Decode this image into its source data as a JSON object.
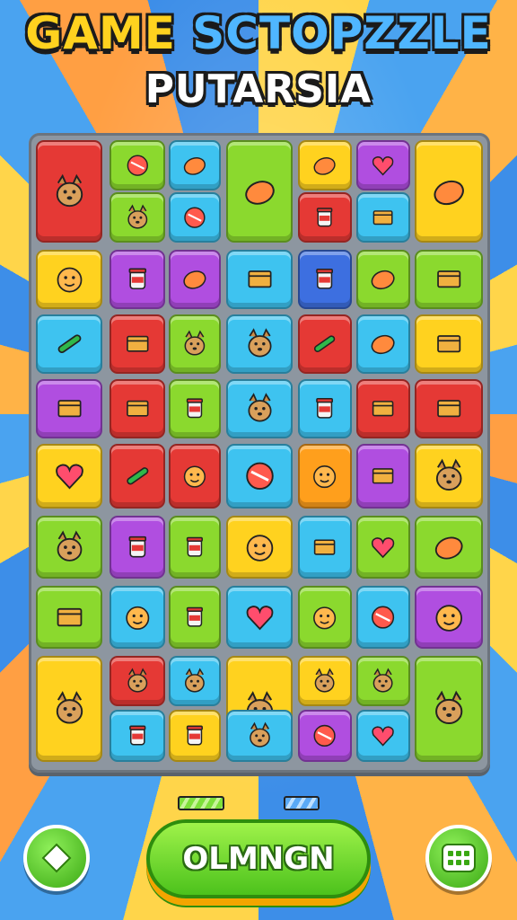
{
  "header": {
    "title_line1_a": "GAME ",
    "title_line1_b": "SCTO",
    "title_line1_c": "PZZLE",
    "title_line2": "PUTARSIA"
  },
  "action_button": {
    "label": "OLMNGN"
  },
  "icons": {
    "left_button": "diamond-icon",
    "right_button": "grid-icon"
  },
  "tiles": [
    {
      "icon": "fox-character",
      "color": "#e53935"
    },
    {
      "icon": "striped-ball",
      "color": "#8bd92e"
    },
    {
      "icon": "yellow-blob",
      "color": "#3ec3f0"
    },
    {
      "icon": "fruit-pile",
      "color": "#8bd92e"
    },
    {
      "icon": "red-fan",
      "color": "#ffd21f"
    },
    {
      "icon": "heart",
      "color": "#b04ee0"
    },
    {
      "icon": "arcade-machine",
      "color": "#ffd21f"
    },
    {
      "icon": "blue-bird",
      "color": "#8bd92e"
    },
    {
      "icon": "green-apple",
      "color": "#3ec3f0"
    },
    {
      "icon": "paper-cup",
      "color": "#e53935"
    },
    {
      "icon": "gift-box",
      "color": "#3ec3f0"
    },
    {
      "icon": "smiley",
      "color": "#ffd21f"
    },
    {
      "icon": "jam-jar",
      "color": "#b04ee0"
    },
    {
      "icon": "lightbulb",
      "color": "#b04ee0"
    },
    {
      "icon": "cheese-block",
      "color": "#3ec3f0"
    },
    {
      "icon": "honey-jar",
      "color": "#3d6fe0"
    },
    {
      "icon": "orange-vase",
      "color": "#8bd92e"
    },
    {
      "icon": "cake-slice",
      "color": "#8bd92e"
    },
    {
      "icon": "green-stick",
      "color": "#3ec3f0"
    },
    {
      "icon": "book",
      "color": "#e53935"
    },
    {
      "icon": "yellow-chick",
      "color": "#8bd92e"
    },
    {
      "icon": "cat-face",
      "color": "#3ec3f0"
    },
    {
      "icon": "red-check",
      "color": "#e53935"
    },
    {
      "icon": "pink-bean",
      "color": "#3ec3f0"
    },
    {
      "icon": "sandwich",
      "color": "#ffd21f"
    },
    {
      "icon": "colored-books",
      "color": "#b04ee0"
    },
    {
      "icon": "layer-cake",
      "color": "#e53935"
    },
    {
      "icon": "soda-can",
      "color": "#8bd92e"
    },
    {
      "icon": "hotdog",
      "color": "#3ec3f0"
    },
    {
      "icon": "drink-cup",
      "color": "#3ec3f0"
    },
    {
      "icon": "picture-frame",
      "color": "#e53935"
    },
    {
      "icon": "green-box",
      "color": "#e53935"
    },
    {
      "icon": "red-bow",
      "color": "#ffd21f"
    },
    {
      "icon": "green-marker",
      "color": "#e53935"
    },
    {
      "icon": "sun-face",
      "color": "#e53935"
    },
    {
      "icon": "target-pin",
      "color": "#3ec3f0"
    },
    {
      "icon": "hat-person",
      "color": "#ff9f1c"
    },
    {
      "icon": "paint-bag",
      "color": "#b04ee0"
    },
    {
      "icon": "black-wolf",
      "color": "#ffd21f"
    },
    {
      "icon": "brown-dog",
      "color": "#8bd92e"
    },
    {
      "icon": "bucket",
      "color": "#b04ee0"
    },
    {
      "icon": "tin-can",
      "color": "#8bd92e"
    },
    {
      "icon": "pink-hair-girl",
      "color": "#ffd21f"
    },
    {
      "icon": "purple-note",
      "color": "#3ec3f0"
    },
    {
      "icon": "heart-lollipop",
      "color": "#8bd92e"
    },
    {
      "icon": "bread-loaf",
      "color": "#8bd92e"
    },
    {
      "icon": "letter-stack",
      "color": "#8bd92e"
    },
    {
      "icon": "orange-face",
      "color": "#3ec3f0"
    },
    {
      "icon": "orange-jar",
      "color": "#8bd92e"
    },
    {
      "icon": "salad-bowl",
      "color": "#3ec3f0"
    },
    {
      "icon": "green-face",
      "color": "#8bd92e"
    },
    {
      "icon": "red-gear",
      "color": "#3ec3f0"
    },
    {
      "icon": "bald-face",
      "color": "#b04ee0"
    },
    {
      "icon": "feather-warrior",
      "color": "#ffd21f"
    },
    {
      "icon": "pink-bird",
      "color": "#e53935"
    },
    {
      "icon": "blue-snail",
      "color": "#3ec3f0"
    },
    {
      "icon": "hotdog-bun",
      "color": "#ffd21f"
    },
    {
      "icon": "yellow-bear",
      "color": "#ffd21f"
    },
    {
      "icon": "gold-bird",
      "color": "#8bd92e"
    },
    {
      "icon": "pink-cupcake",
      "color": "#3ec3f0"
    },
    {
      "icon": "paint-can",
      "color": "#ffd21f"
    },
    {
      "icon": "purple-cat",
      "color": "#3ec3f0"
    },
    {
      "icon": "orange-ball",
      "color": "#b04ee0"
    },
    {
      "icon": "rainbow-drop",
      "color": "#3ec3f0"
    },
    {
      "icon": "orange-pet",
      "color": "#8bd92e"
    }
  ],
  "accent_colors": {
    "board": "#8d96a0",
    "green": "#4cc21c",
    "gold": "#ffd21f"
  }
}
